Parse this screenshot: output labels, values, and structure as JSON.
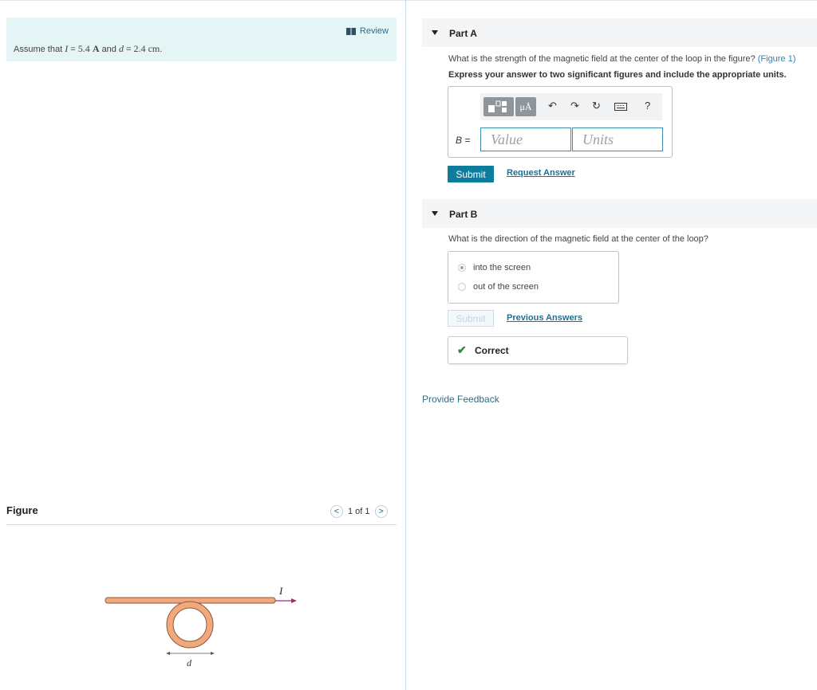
{
  "intro": {
    "review_label": "Review",
    "prefix": "Assume that",
    "i_var": "I",
    "eq1": "=",
    "i_value": "5.4",
    "i_unit": "A",
    "and": "and",
    "d_var": "d",
    "eq2": "=",
    "d_value": "2.4",
    "d_unit": "cm",
    "period": "."
  },
  "figure": {
    "title": "Figure",
    "pager": "1 of 1",
    "prev_glyph": "<",
    "next_glyph": ">",
    "current_label": "I",
    "diameter_label": "d",
    "wire_color": "#f2a77d",
    "arrow_color": "#a0287a"
  },
  "partA": {
    "label": "Part A",
    "question": "What is the strength of the magnetic field at the center of the loop in the figure?",
    "figure_link": "(Figure 1)",
    "instruction": "Express your answer to two significant figures and include the appropriate units.",
    "toolbar_units": "μÅ",
    "toolbar_help": "?",
    "var_label": "B =",
    "value_placeholder": "Value",
    "units_placeholder": "Units",
    "submit": "Submit",
    "request": "Request Answer"
  },
  "partB": {
    "label": "Part B",
    "question": "What is the direction of the magnetic field at the center of the loop?",
    "options": [
      "into the screen",
      "out of the screen"
    ],
    "selected_index": 0,
    "submit": "Submit",
    "previous": "Previous Answers",
    "result": "Correct"
  },
  "feedback": "Provide Feedback"
}
